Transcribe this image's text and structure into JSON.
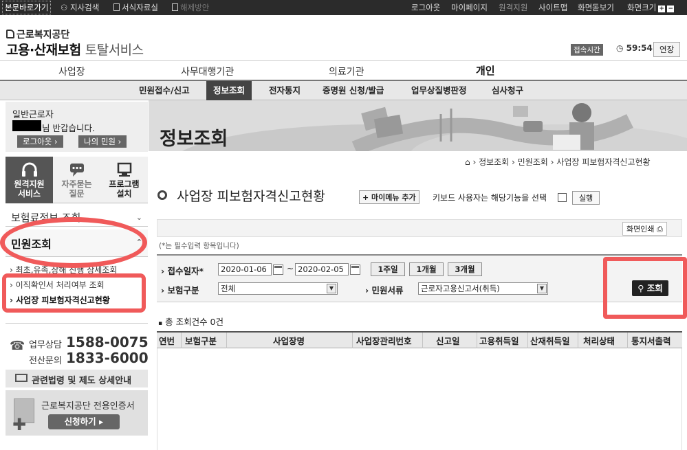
{
  "topbar": {
    "skip_link": "본문바로가기",
    "branch_search": "지사검색",
    "forms_room": "서식자료실",
    "dim_item": "해제방안",
    "logout": "로그아웃",
    "mypage": "마이페이지",
    "remote": "원격지원",
    "sitemap": "사이트맵",
    "zoom_label": "화면돋보기",
    "screen_size": "화면크기"
  },
  "header": {
    "org_name": "근로복지공단",
    "service_bold": "고용·산재보험",
    "service_light": "토탈서비스",
    "session_label": "접속시간",
    "timer": "59:54",
    "extend": "연장"
  },
  "main_nav": [
    "사업장",
    "사무대행기관",
    "의료기관",
    "개인"
  ],
  "sub_nav": [
    "민원접수/신고",
    "정보조회",
    "전자통지",
    "증명원 신청/발급",
    "업무상질병판정",
    "심사청구"
  ],
  "sidebar": {
    "user_type": "일반근로자",
    "greeting": "님 반갑습니다.",
    "logout_btn": "로그아웃",
    "my_civil_btn": "나의 민원",
    "quick_tabs": [
      {
        "l1": "원격지원",
        "l2": "서비스"
      },
      {
        "l1": "자주묻는",
        "l2": "질문"
      },
      {
        "l1": "프로그램",
        "l2": "설치"
      }
    ],
    "menu_insurance": "보험료정보 조회",
    "menu_civil": "민원조회",
    "sub_items": [
      "최초,유족,장해 진행 상세조회",
      "이직확인서 처리여부 조회",
      "사업장 피보험자격신고현황"
    ],
    "call1_label": "업무상담",
    "call1_num": "1588-0075",
    "call2_label": "전산문의",
    "call2_num": "1833-6000",
    "law_link": "관련법령 및 제도 상세안내",
    "cert_text": "근로복지공단 전용인증서",
    "cert_btn": "신청하기"
  },
  "page": {
    "heading": "정보조회",
    "breadcrumb": [
      "정보조회",
      "민원조회",
      "사업장 피보험자격신고현황"
    ],
    "title": "사업장 피보험자격신고현황",
    "mymenu_btn": "+ 마이메뉴 추가",
    "keyboard_text": "키보드 사용자는 해당기능을 선택",
    "run_btn": "실행",
    "print_btn": "화면인쇄",
    "required_note": "(*는 필수입력 항목입니다)"
  },
  "search": {
    "date_label": "접수일자",
    "date_from": "2020-01-06",
    "date_to": "2020-02-05",
    "range_buttons": [
      "1주일",
      "1개월",
      "3개월"
    ],
    "insurance_label": "보험구분",
    "insurance_value": "전체",
    "civil_type_label": "민원서류",
    "civil_type_value": "근로자고용신고서(취득)",
    "search_btn": "조회"
  },
  "results": {
    "total_text": "총 조회건수 0건",
    "columns": [
      "연번",
      "보험구분",
      "사업장명",
      "사업장관리번호",
      "신고일",
      "고용취득일",
      "산재취득일",
      "처리상태",
      "통지서출력"
    ]
  },
  "colors": {
    "highlight_ring": "#f05a5a",
    "active_tab": "#444444"
  }
}
